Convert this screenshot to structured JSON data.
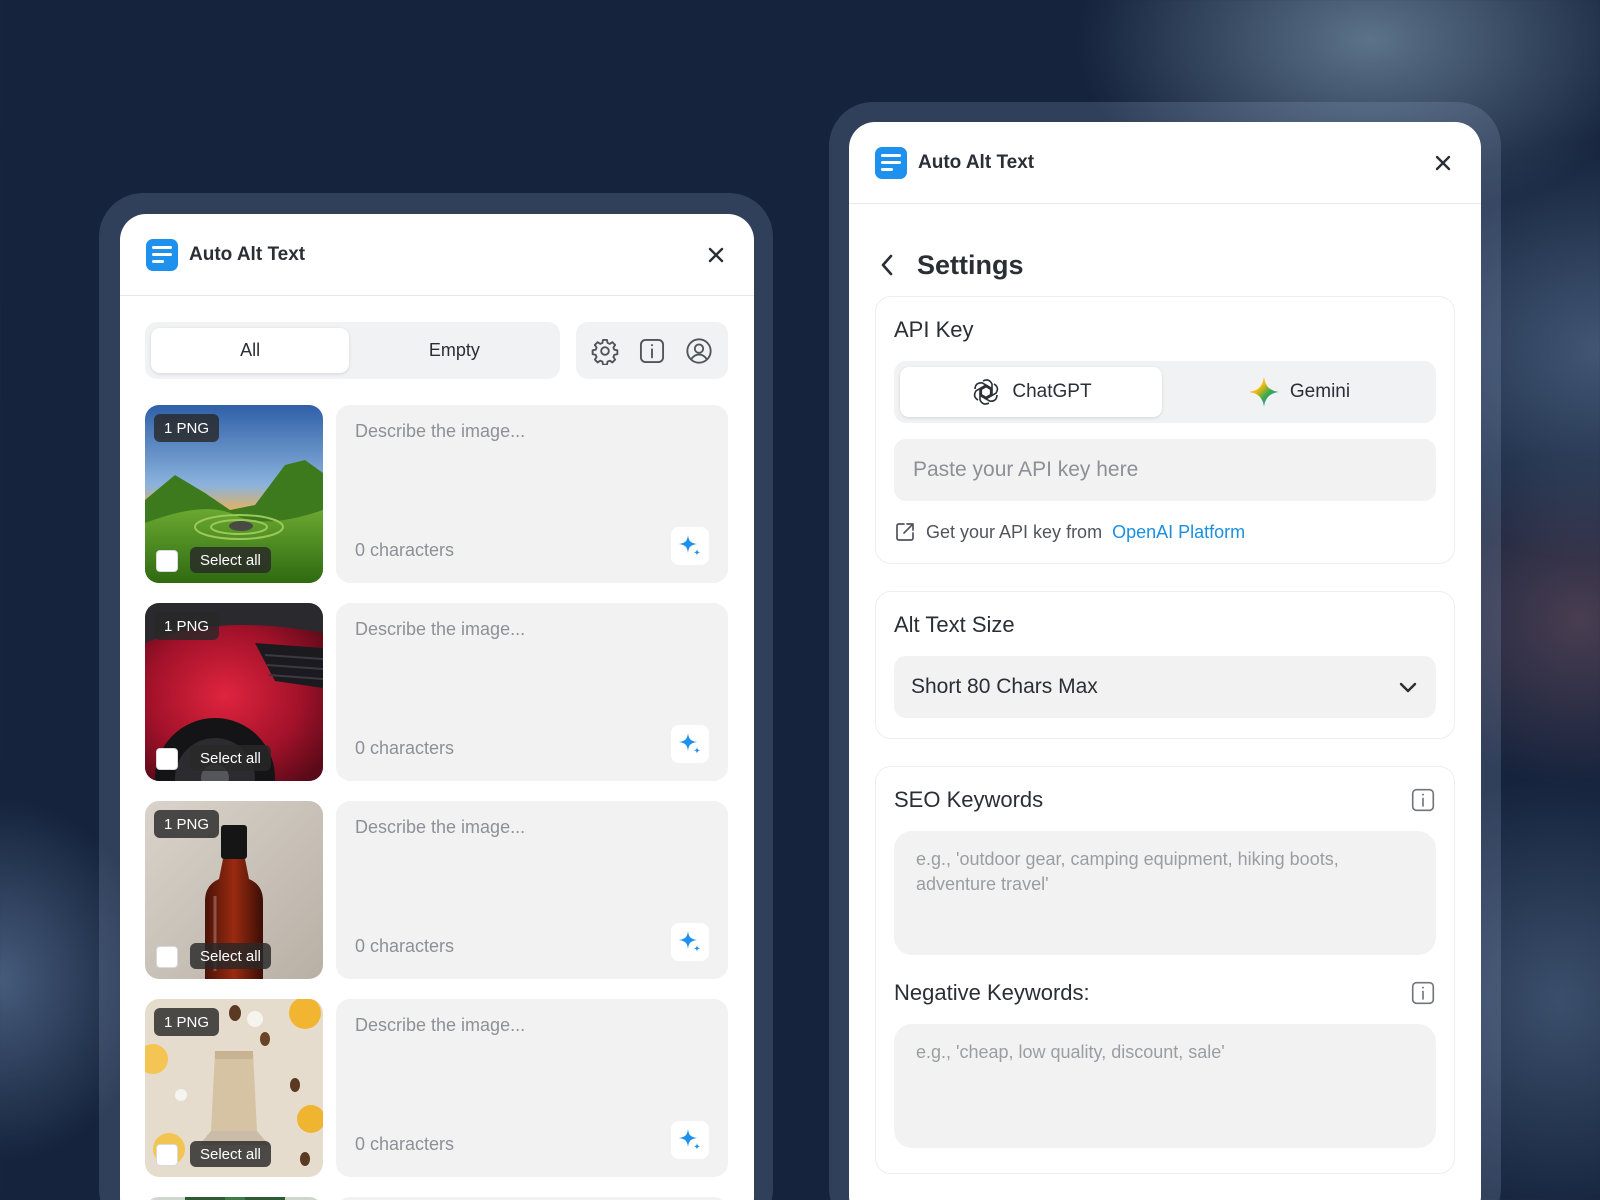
{
  "app": {
    "title": "Auto Alt Text"
  },
  "left_panel": {
    "filter_tabs": [
      {
        "label": "All",
        "active": true
      },
      {
        "label": "Empty",
        "active": false
      }
    ],
    "toolbar_icons": [
      "gear-icon",
      "info-icon",
      "user-icon"
    ],
    "images": [
      {
        "badge": "1 PNG",
        "select_label": "Select all",
        "placeholder": "Describe the image...",
        "count": "0 characters",
        "scene": "landscape"
      },
      {
        "badge": "1 PNG",
        "select_label": "Select all",
        "placeholder": "Describe the image...",
        "count": "0 characters",
        "scene": "car"
      },
      {
        "badge": "1 PNG",
        "select_label": "Select all",
        "placeholder": "Describe the image...",
        "count": "0 characters",
        "scene": "bottle"
      },
      {
        "badge": "1 PNG",
        "select_label": "Select all",
        "placeholder": "Describe the image...",
        "count": "0 characters",
        "scene": "coffee-bag"
      }
    ]
  },
  "right_panel": {
    "settings_title": "Settings",
    "api_key": {
      "title": "API Key",
      "providers": [
        {
          "label": "ChatGPT",
          "icon": "openai-icon",
          "active": true
        },
        {
          "label": "Gemini",
          "icon": "gemini-icon",
          "active": false
        }
      ],
      "placeholder": "Paste your API key here",
      "link_prefix": "Get your API key from",
      "link_text": "OpenAI Platform"
    },
    "alt_text_size": {
      "title": "Alt Text Size",
      "selected": "Short 80 Chars Max"
    },
    "seo_keywords": {
      "title": "SEO Keywords",
      "placeholder": "e.g., 'outdoor gear, camping equipment, hiking boots, adventure travel'"
    },
    "negative_keywords": {
      "title": "Negative Keywords:",
      "placeholder": "e.g., 'cheap, low quality, discount, sale'"
    }
  },
  "colors": {
    "accent": "#1e90ee",
    "link": "#1a8fe0",
    "background": "#15233c"
  }
}
